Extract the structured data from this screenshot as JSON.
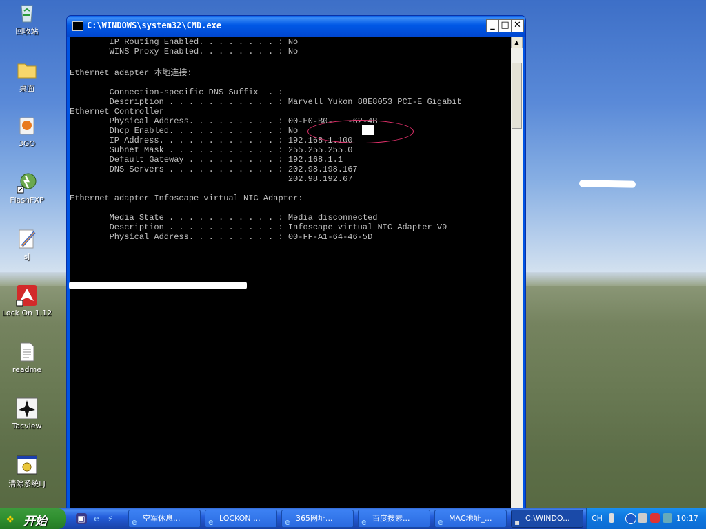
{
  "desktop": {
    "icons": [
      {
        "label": "回收站",
        "icon": "recycle-bin-icon"
      },
      {
        "label": "桌面",
        "icon": "folder-icon"
      },
      {
        "label": "3GO",
        "icon": "app-3go-icon"
      },
      {
        "label": "FlashFXP",
        "icon": "flashfxp-icon"
      },
      {
        "label": "sJ",
        "icon": "pen-icon"
      },
      {
        "label": "Lock On 1.12",
        "icon": "lockon-icon"
      },
      {
        "label": "readme",
        "icon": "text-file-icon"
      },
      {
        "label": "Tacview",
        "icon": "tacview-icon"
      },
      {
        "label": "清除系统LJ",
        "icon": "batch-file-icon"
      }
    ]
  },
  "window": {
    "title": "C:\\WINDOWS\\system32\\CMD.exe",
    "minimize": "_",
    "maximize": "□",
    "close": "✕",
    "console_lines": [
      "        IP Routing Enabled. . . . . . . . : No",
      "        WINS Proxy Enabled. . . . . . . . : No",
      "",
      "Ethernet adapter 本地连接:",
      "",
      "        Connection-specific DNS Suffix  . :",
      "        Description . . . . . . . . . . . : Marvell Yukon 88E8053 PCI-E Gigabit",
      "Ethernet Controller",
      "        Physical Address. . . . . . . . . : 00-E0-B0-   -62-4B",
      "        Dhcp Enabled. . . . . . . . . . . : No",
      "        IP Address. . . . . . . . . . . . : 192.168.1.100",
      "        Subnet Mask . . . . . . . . . . . : 255.255.255.0",
      "        Default Gateway . . . . . . . . . : 192.168.1.1",
      "        DNS Servers . . . . . . . . . . . : 202.98.198.167",
      "                                            202.98.192.67",
      "",
      "Ethernet adapter Infoscape virtual NIC Adapter:",
      "",
      "        Media State . . . . . . . . . . . : Media disconnected",
      "        Description . . . . . . . . . . . : Infoscape virtual NIC Adapter V9",
      "        Physical Address. . . . . . . . . : 00-FF-A1-64-46-5D"
    ]
  },
  "taskbar": {
    "start_label": "开始",
    "quick_launch": [
      "show-desktop-icon",
      "ie-icon",
      "media-icon"
    ],
    "tasks": [
      {
        "label": "空军休息...",
        "icon": "ie-icon",
        "active": false
      },
      {
        "label": "LOCKON ...",
        "icon": "ie-icon",
        "active": false
      },
      {
        "label": "365网址...",
        "icon": "ie-icon",
        "active": false
      },
      {
        "label": "百度搜索...",
        "icon": "ie-icon",
        "active": false
      },
      {
        "label": "MAC地址_...",
        "icon": "ie-icon",
        "active": false
      },
      {
        "label": "C:\\WINDO...",
        "icon": "cmd-icon",
        "active": true
      }
    ],
    "tray": {
      "lang": "CH",
      "clock": "10:17",
      "icons": [
        "expand-tray-icon",
        "network-icon",
        "antivirus-icon",
        "security-icon"
      ]
    }
  }
}
